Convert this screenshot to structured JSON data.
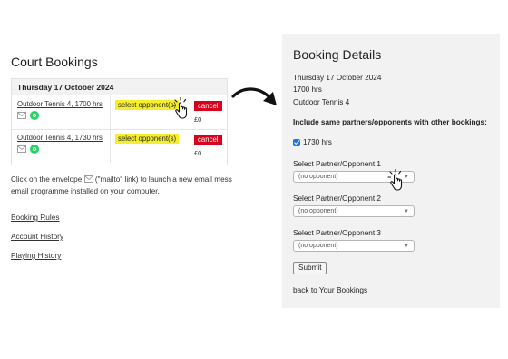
{
  "left": {
    "title": "Court Bookings",
    "date_header": "Thursday 17 October 2024",
    "bookings": [
      {
        "court": "Outdoor Tennis 4, 1700 hrs",
        "select_label": "select opponent(s)",
        "cancel_label": "cancel",
        "fee": "£0"
      },
      {
        "court": "Outdoor Tennis 4, 1730 hrs",
        "select_label": "select opponent(s)",
        "cancel_label": "cancel",
        "fee": "£0"
      }
    ],
    "info_line1_pre": "Click on the envelope",
    "info_line1_post": "(\"mailto\" link) to launch a new email mess",
    "info_line2": "email programme installed on your computer.",
    "links": [
      "Booking Rules",
      "Account History",
      "Playing History"
    ]
  },
  "right": {
    "title": "Booking Details",
    "date": "Thursday 17 October 2024",
    "time": "1700 hrs",
    "court": "Outdoor Tennis 4",
    "include_heading": "Include same partners/opponents with other bookings:",
    "checkbox_label": "1730 hrs",
    "checkbox_checked": true,
    "selects": [
      {
        "label": "Select Partner/Opponent 1",
        "value": "(no opponent)"
      },
      {
        "label": "Select Partner/Opponent 2",
        "value": "(no opponent)"
      },
      {
        "label": "Select Partner/Opponent 3",
        "value": "(no opponent)"
      }
    ],
    "submit_label": "Submit",
    "back_link": "back to Your Bookings"
  },
  "colors": {
    "highlight": "#f4ef2a",
    "cancel": "#d9001b",
    "whatsapp": "#25d366",
    "checkbox": "#1a73e8",
    "panel_bg": "#f2f2f2"
  },
  "icons": [
    "envelope-icon",
    "whatsapp-icon",
    "hand-pointer-icon",
    "curved-arrow-icon",
    "chevron-down-icon"
  ]
}
